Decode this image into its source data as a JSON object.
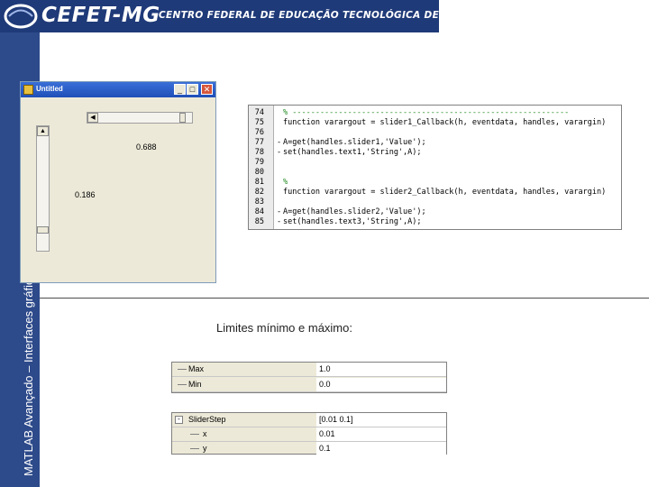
{
  "header": {
    "brand": "CEFET-MG",
    "tagline": "CENTRO FEDERAL DE EDUCAÇÃO TECNOLÓGICA DE MINAS GERAIS"
  },
  "sidebar": {
    "title": "MATLAB Avançado – Interfaces gráficas"
  },
  "figure_window": {
    "title": "Untitled",
    "slider1_value_text": "0.688",
    "slider2_value_text": "0.186",
    "slider1_level": 0.93,
    "slider2_level": 0.16
  },
  "code_editor": {
    "lines": [
      {
        "num": "74",
        "mark": "",
        "text": "% ------------------------------------------------------------",
        "type": "comment"
      },
      {
        "num": "75",
        "mark": "",
        "text": "function varargout = slider1_Callback(h, eventdata, handles, varargin)",
        "type": "code"
      },
      {
        "num": "76",
        "mark": "",
        "text": "",
        "type": "code"
      },
      {
        "num": "77",
        "mark": "-",
        "text": "A=get(handles.slider1,'Value');",
        "type": "code"
      },
      {
        "num": "78",
        "mark": "-",
        "text": "set(handles.text1,'String',A);",
        "type": "code"
      },
      {
        "num": "79",
        "mark": "",
        "text": "",
        "type": "code"
      },
      {
        "num": "80",
        "mark": "",
        "text": "",
        "type": "code"
      },
      {
        "num": "81",
        "mark": "",
        "text": "%",
        "type": "comment"
      },
      {
        "num": "82",
        "mark": "",
        "text": "function varargout = slider2_Callback(h, eventdata, handles, varargin)",
        "type": "code"
      },
      {
        "num": "83",
        "mark": "",
        "text": "",
        "type": "code"
      },
      {
        "num": "84",
        "mark": "-",
        "text": "A=get(handles.slider2,'Value');",
        "type": "code"
      },
      {
        "num": "85",
        "mark": "-",
        "text": "set(handles.text3,'String',A);",
        "type": "code"
      }
    ]
  },
  "caption": "Limites mínimo e máximo:",
  "limits_table": {
    "rows": [
      {
        "name": "Max",
        "value": "1.0"
      },
      {
        "name": "Min",
        "value": "0.0"
      }
    ]
  },
  "slider_step_table": {
    "rows": [
      {
        "name": "SliderStep",
        "value": "[0.01 0.1]",
        "expander": "-"
      },
      {
        "name": "x",
        "value": "0.01"
      },
      {
        "name": "y",
        "value": "0.1"
      }
    ]
  }
}
